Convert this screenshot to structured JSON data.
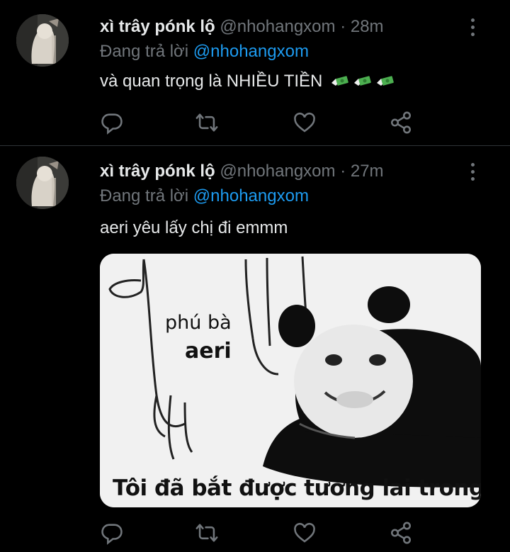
{
  "tweets": [
    {
      "name": "xì trây pónk lộ",
      "handle": "@nhohangxom",
      "separator": "·",
      "time": "28m",
      "replying_prefix": "Đang trả lời",
      "replying_to": "@nhohangxom",
      "text": "và quan trọng là NHIỀU TIỀN",
      "emoji": [
        "money-with-wings",
        "money-with-wings",
        "money-with-wings"
      ]
    },
    {
      "name": "xì trây pónk lộ",
      "handle": "@nhohangxom",
      "separator": "·",
      "time": "27m",
      "replying_prefix": "Đang trả lời",
      "replying_to": "@nhohangxom",
      "text": "aeri yêu lấy chị đi emmm",
      "media": {
        "label_line1": "phú bà",
        "label_line2": "aeri",
        "caption": "Tôi đã bắt được tương lai trong tay"
      }
    }
  ],
  "actions": {
    "icons": [
      "reply-icon",
      "retweet-icon",
      "like-icon",
      "share-icon"
    ]
  },
  "colors": {
    "background": "#000000",
    "text": "#e7e9ea",
    "muted": "#71767b",
    "accent": "#1d9bf0",
    "divider": "#2f3336"
  }
}
